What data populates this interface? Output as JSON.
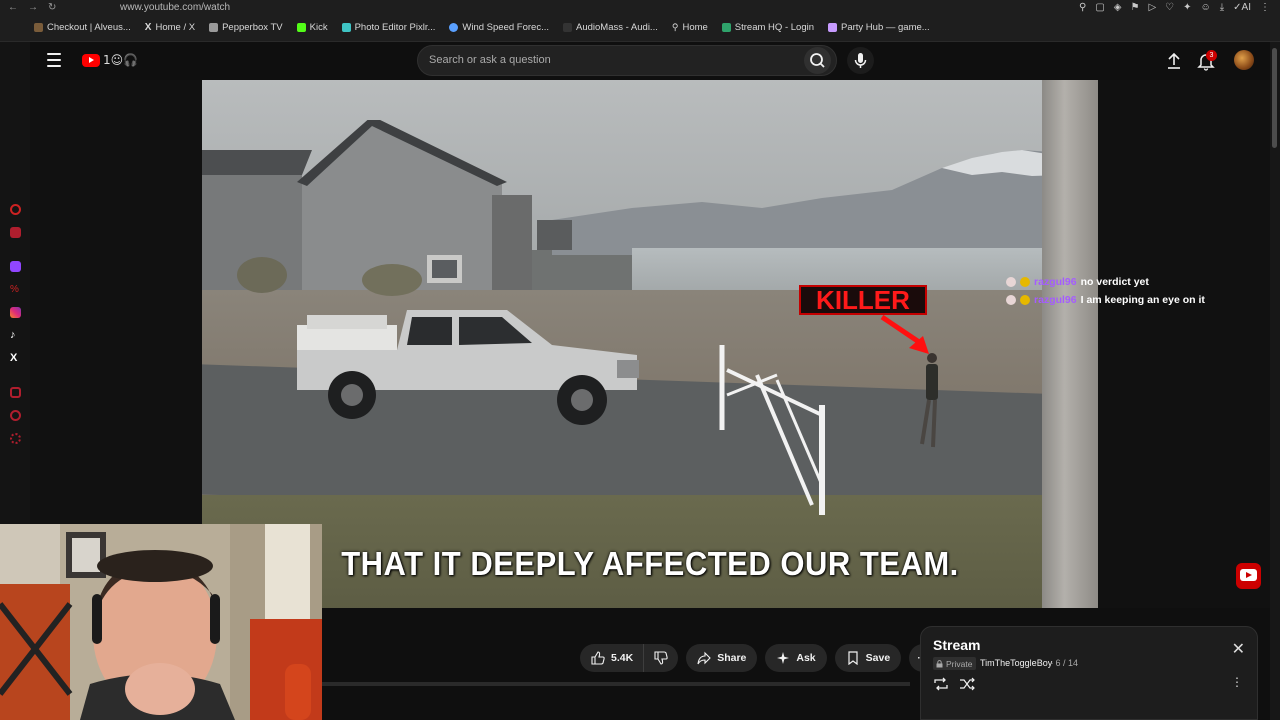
{
  "browser": {
    "url": "www.youtube.com/watch",
    "bookmarks": [
      {
        "label": "Checkout | Alveus...",
        "color": "#7a5c3a"
      },
      {
        "label": "Home / X",
        "color": "#ffffff"
      },
      {
        "label": "Pepperbox TV",
        "color": "#9a9a9a"
      },
      {
        "label": "Kick",
        "color": "#53fc18"
      },
      {
        "label": "Photo Editor Pixlr...",
        "color": "#3fc4c4"
      },
      {
        "label": "Wind Speed Forec...",
        "color": "#5aa0ff"
      },
      {
        "label": "AudioMass - Audi...",
        "color": "#333333"
      },
      {
        "label": "Home",
        "color": "#dddddd"
      },
      {
        "label": "Stream HQ - Login",
        "color": "#2fa36b"
      },
      {
        "label": "Party Hub — game...",
        "color": "#c79bff"
      }
    ]
  },
  "header": {
    "logo_doodle": "1☺🎧",
    "search_placeholder": "Search or ask a question",
    "notification_count": "3"
  },
  "video": {
    "overlay_label": "KILLER",
    "caption": "THAT IT DEEPLY AFFECTED OUR TEAM."
  },
  "chat": [
    {
      "user": "razgul96",
      "message": "no verdict yet"
    },
    {
      "user": "razgul96",
      "message": "I am keeping an eye on it"
    }
  ],
  "actions": {
    "like_count": "5.4K",
    "share_label": "Share",
    "ask_label": "Ask",
    "save_label": "Save",
    "more_label": "⋯"
  },
  "playlist_panel": {
    "title": "Stream",
    "privacy": "Private",
    "owner": "TimTheToggleBoy",
    "position": "- 6 / 14"
  },
  "colors": {
    "youtube_red": "#ff0000",
    "chat_username": "#a55cff",
    "killer_red": "#ff1a1a"
  }
}
